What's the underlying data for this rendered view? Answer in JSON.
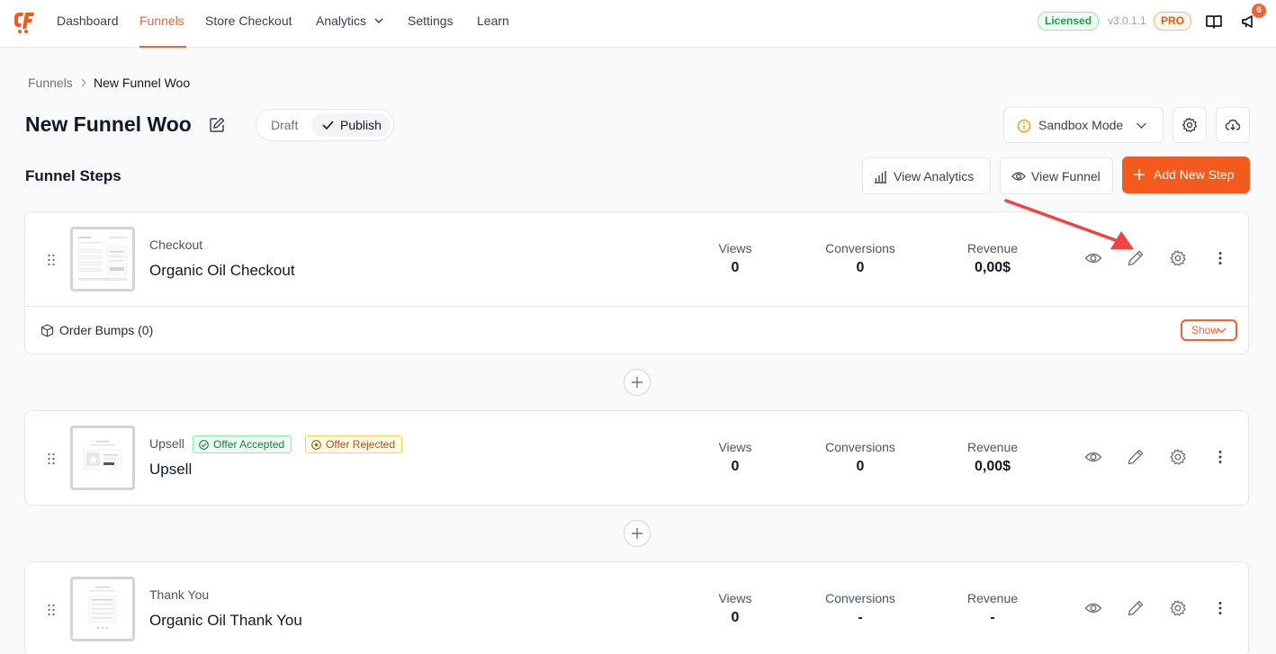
{
  "nav": {
    "items": [
      "Dashboard",
      "Funnels",
      "Store Checkout",
      "Analytics",
      "Settings",
      "Learn"
    ],
    "active": "Funnels",
    "licensed": "Licensed",
    "version": "v3.0.1.1",
    "pro": "PRO",
    "notification_count": "6"
  },
  "breadcrumb": {
    "parent": "Funnels",
    "current": "New Funnel Woo"
  },
  "header": {
    "title": "New Funnel Woo",
    "status_draft": "Draft",
    "status_publish": "Publish",
    "sandbox_label": "Sandbox Mode"
  },
  "steps_section": {
    "title": "Funnel Steps",
    "view_analytics": "View Analytics",
    "view_funnel": "View Funnel",
    "add_step": "Add New Step"
  },
  "stat_labels": {
    "views": "Views",
    "conversions": "Conversions",
    "revenue": "Revenue"
  },
  "steps": [
    {
      "type": "Checkout",
      "name": "Organic Oil Checkout",
      "views": "0",
      "conversions": "0",
      "revenue": "0,00$",
      "order_bumps": "Order Bumps (0)",
      "show_label": "Show"
    },
    {
      "type": "Upsell",
      "name": "Upsell",
      "tag_accept": "Offer Accepted",
      "tag_reject": "Offer Rejected",
      "views": "0",
      "conversions": "0",
      "revenue": "0,00$"
    },
    {
      "type": "Thank You",
      "name": "Organic Oil Thank You",
      "views": "0",
      "conversions": "-",
      "revenue": "-"
    }
  ],
  "colors": {
    "accent": "#f25a1e",
    "success": "#16a34a",
    "warning": "#b45309"
  }
}
